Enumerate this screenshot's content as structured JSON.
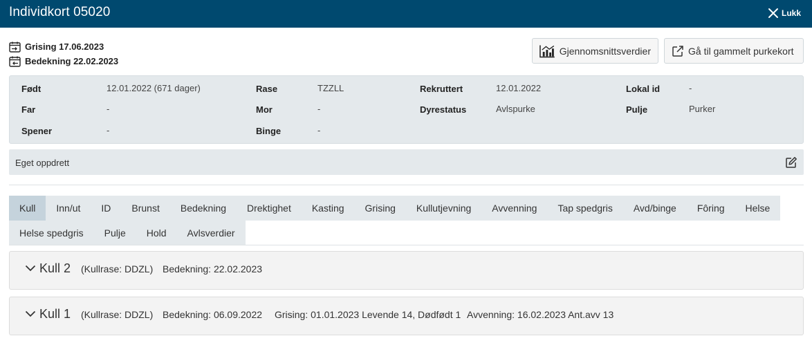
{
  "window": {
    "title": "Individkort 05020",
    "close_label": "Lukk"
  },
  "dates": {
    "grising": "Grising 17.06.2023",
    "bedekning": "Bedekning 22.02.2023"
  },
  "buttons": {
    "average": "Gjennomsnittsverdier",
    "old_card": "Gå til gammelt purkekort"
  },
  "info": {
    "fodt_label": "Født",
    "fodt_value": "12.01.2022 (671 dager)",
    "far_label": "Far",
    "far_value": "-",
    "spener_label": "Spener",
    "spener_value": "-",
    "rase_label": "Rase",
    "rase_value": "TZZLL",
    "mor_label": "Mor",
    "mor_value": "-",
    "binge_label": "Binge",
    "binge_value": "-",
    "rekruttert_label": "Rekruttert",
    "rekruttert_value": "12.01.2022",
    "dyrestatus_label": "Dyrestatus",
    "dyrestatus_value": "Avlspurke",
    "lokal_label": "Lokal id",
    "lokal_value": "-",
    "pulje_label": "Pulje",
    "pulje_value": "Purker"
  },
  "note": {
    "text": "Eget oppdrett"
  },
  "tabs": {
    "row1": [
      "Kull",
      "Inn/ut",
      "ID",
      "Brunst",
      "Bedekning",
      "Drektighet",
      "Kasting",
      "Grising",
      "Kullutjevning",
      "Avvenning",
      "Tap spedgris",
      "Avd/binge",
      "Fôring",
      "Helse"
    ],
    "row2": [
      "Helse spedgris",
      "Pulje",
      "Hold",
      "Avlsverdier"
    ],
    "active": "Kull"
  },
  "kull": [
    {
      "name": "Kull 2",
      "rase": "(Kullrase: DDZL)",
      "bedekning": "Bedekning: 22.02.2023"
    },
    {
      "name": "Kull 1",
      "rase": "(Kullrase: DDZL)",
      "bedekning": "Bedekning: 06.09.2022",
      "grising": "Grising: 01.01.2023 Levende 14, Dødfødt 1",
      "avvenning": "Avvenning: 16.02.2023 Ant.avv 13"
    }
  ],
  "colors": {
    "header_bg": "#00496f",
    "panel_bg": "#e4e9ec",
    "active_tab": "#c5d3dc"
  }
}
